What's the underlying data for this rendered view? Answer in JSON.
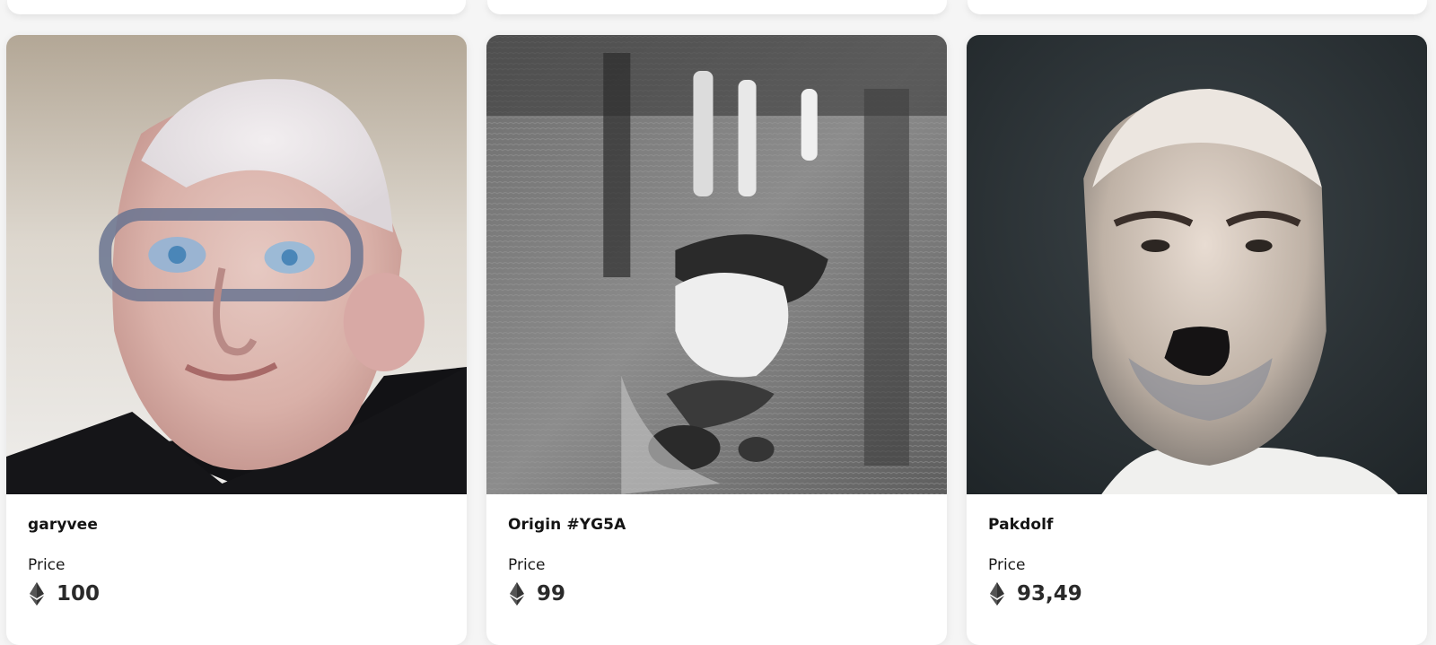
{
  "cards": [
    {
      "name": "garyvee",
      "price_label": "Price",
      "price": "100",
      "currency_icon": "ethereum-icon"
    },
    {
      "name": "Origin #YG5A",
      "price_label": "Price",
      "price": "99",
      "currency_icon": "ethereum-icon"
    },
    {
      "name": "Pakdolf",
      "price_label": "Price",
      "price": "93,49",
      "currency_icon": "ethereum-icon"
    }
  ],
  "colors": {
    "page_background": "#f5f5f5",
    "card_background": "#ffffff",
    "title_text": "#141414",
    "price_text": "#2a2a2a"
  }
}
